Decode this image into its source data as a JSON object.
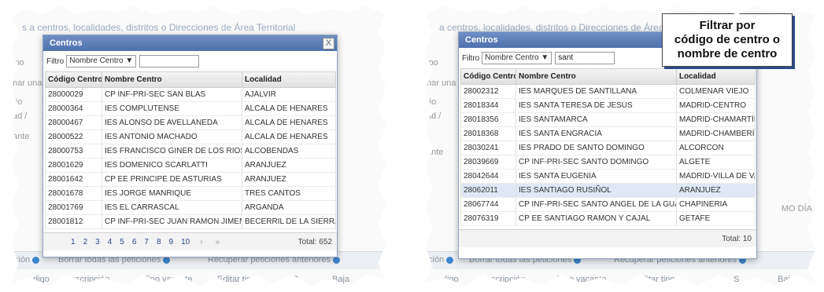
{
  "background": {
    "title": "s a centros, localidades, distritos o Direcciones de Área Territorial",
    "title_right": "a centros, localidades, distritos o Direcciones de Área",
    "side_labels": [
      "ipo",
      "nar una",
      "rio",
      "ad /",
      "ante"
    ],
    "action_bar": {
      "petition": "ción",
      "delete_all": "Borrar todas las peticiones",
      "recover": "Recuperar peticiones anteriores"
    },
    "right_label": "MO DÍA",
    "bottom_columns": [
      "digo",
      "Descripción",
      "Tipo vacante",
      "Editar tipo",
      "S",
      "Baja"
    ]
  },
  "dialog_left": {
    "title": "Centros",
    "close": "X",
    "filter_label": "Filtro",
    "filter_select": "Nombre Centro ▼",
    "filter_value": "",
    "columns": [
      "Código Centro",
      "Nombre Centro",
      "Localidad"
    ],
    "rows": [
      [
        "28000029",
        "CP INF-PRI-SEC SAN BLAS",
        "AJALVIR"
      ],
      [
        "28000364",
        "IES COMPLUTENSE",
        "ALCALA DE HENARES"
      ],
      [
        "28000467",
        "IES ALONSO DE AVELLANEDA",
        "ALCALA DE HENARES"
      ],
      [
        "28000522",
        "IES ANTONIO MACHADO",
        "ALCALA DE HENARES"
      ],
      [
        "28000753",
        "IES FRANCISCO GINER DE LOS RIOS",
        "ALCOBENDAS"
      ],
      [
        "28001629",
        "IES DOMENICO SCARLATTI",
        "ARANJUEZ"
      ],
      [
        "28001642",
        "CP EE PRINCIPE DE ASTURIAS",
        "ARANJUEZ"
      ],
      [
        "28001678",
        "IES JORGE MANRIQUE",
        "TRES CANTOS"
      ],
      [
        "28001769",
        "IES EL CARRASCAL",
        "ARGANDA"
      ],
      [
        "28001812",
        "CP INF-PRI-SEC JUAN RAMON JIMENEZ",
        "BECERRIL DE LA SIERRA"
      ]
    ],
    "pages": [
      "1",
      "2",
      "3",
      "4",
      "5",
      "6",
      "7",
      "8",
      "9",
      "10"
    ],
    "next": "›",
    "last": "»",
    "total": "Total: 652"
  },
  "dialog_right": {
    "title": "Centros",
    "filter_label": "Filtro",
    "filter_select": "Nombre Centro ▼",
    "filter_value": "sant",
    "columns": [
      "Código Centro",
      "Nombre Centro",
      "Localidad"
    ],
    "rows": [
      [
        "28002312",
        "IES MARQUES DE SANTILLANA",
        "COLMENAR VIEJO"
      ],
      [
        "28018344",
        "IES SANTA TERESA DE JESUS",
        "MADRID-CENTRO"
      ],
      [
        "28018356",
        "IES SANTAMARCA",
        "MADRID-CHAMARTÍN"
      ],
      [
        "28018368",
        "IES SANTA ENGRACIA",
        "MADRID-CHAMBERÍ"
      ],
      [
        "28030241",
        "IES PRADO DE SANTO DOMINGO",
        "ALCORCON"
      ],
      [
        "28039669",
        "CP INF-PRI-SEC SANTO DOMINGO",
        "ALGETE"
      ],
      [
        "28042644",
        "IES SANTA EUGENIA",
        "MADRID-VILLA DE VALLECAS"
      ],
      [
        "28062011",
        "IES SANTIAGO RUSIÑOL",
        "ARANJUEZ"
      ],
      [
        "28067744",
        "CP INF-PRI-SEC SANTO ANGEL DE LA GUARDA",
        "CHAPINERIA"
      ],
      [
        "28076319",
        "CP EE SANTIAGO RAMON Y CAJAL",
        "GETAFE"
      ]
    ],
    "total": "Total: 10"
  },
  "callout": {
    "line1": "Filtrar por",
    "line2": "código de centro o",
    "line3": "nombre de centro"
  },
  "colors": {
    "dialog_header": "#5b7cb6",
    "highlight_row": "#dfe8f4",
    "callout_shadow": "#2c4a8c"
  }
}
